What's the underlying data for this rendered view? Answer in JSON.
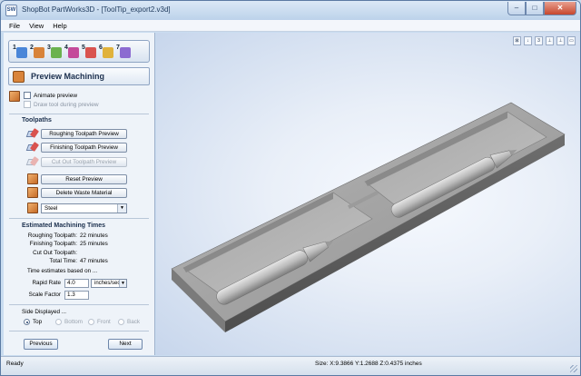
{
  "window": {
    "title": "ShopBot PartWorks3D - [ToolTip_export2.v3d]",
    "app_icon": "SW"
  },
  "window_buttons": {
    "minimize": "–",
    "maximize": "□",
    "close": "✕"
  },
  "menu": [
    "File",
    "View",
    "Help"
  ],
  "toolbar_steps": [
    {
      "num": "1",
      "color": "#4a86d8"
    },
    {
      "num": "2",
      "color": "#d8833a"
    },
    {
      "num": "3",
      "color": "#6bb24f"
    },
    {
      "num": "4",
      "color": "#c44a9a"
    },
    {
      "num": "5",
      "color": "#d9534f"
    },
    {
      "num": "6",
      "color": "#e0b23b"
    },
    {
      "num": "7",
      "color": "#8c6bd1"
    }
  ],
  "heading": "Preview Machining",
  "options": {
    "animate_preview": "Animate preview",
    "draw_tool": "Draw tool during preview"
  },
  "toolpaths": {
    "title": "Toolpaths",
    "roughing": "Roughing Toolpath Preview",
    "finishing": "Finishing Toolpath Preview",
    "cutout": "Cut Out Toolpath Preview"
  },
  "actions": {
    "reset": "Reset Preview",
    "delete_waste": "Delete Waste Material"
  },
  "material": {
    "selected": "Steel"
  },
  "times": {
    "title": "Estimated Machining Times",
    "rows": [
      {
        "label": "Roughing Toolpath:",
        "value": "22 minutes"
      },
      {
        "label": "Finishing Toolpath:",
        "value": "25 minutes"
      },
      {
        "label": "Cut Out Toolpath:",
        "value": ""
      },
      {
        "label": "Total Time:",
        "value": "47 minutes"
      }
    ],
    "based_on": "Time estimates based on ...",
    "rapid_label": "Rapid Rate",
    "rapid_value": "4.0",
    "rapid_unit": "inches/sec",
    "scale_label": "Scale Factor",
    "scale_value": "1.3"
  },
  "side": {
    "title": "Side Displayed ...",
    "top": "Top",
    "bottom": "Bottom",
    "front": "Front",
    "back": "Back"
  },
  "nav": {
    "previous": "Previous",
    "next": "Next"
  },
  "view_icons": [
    "⊠",
    "↓",
    "3",
    "⊥",
    "⊥",
    "▭"
  ],
  "status": {
    "left": "Ready",
    "right": "Size: X:9.3866 Y:1.2688 Z:0.4375 inches"
  },
  "colors": {
    "accent": "#d8843a",
    "panel": "#eef3f9",
    "viewport": "#e9eff8"
  }
}
